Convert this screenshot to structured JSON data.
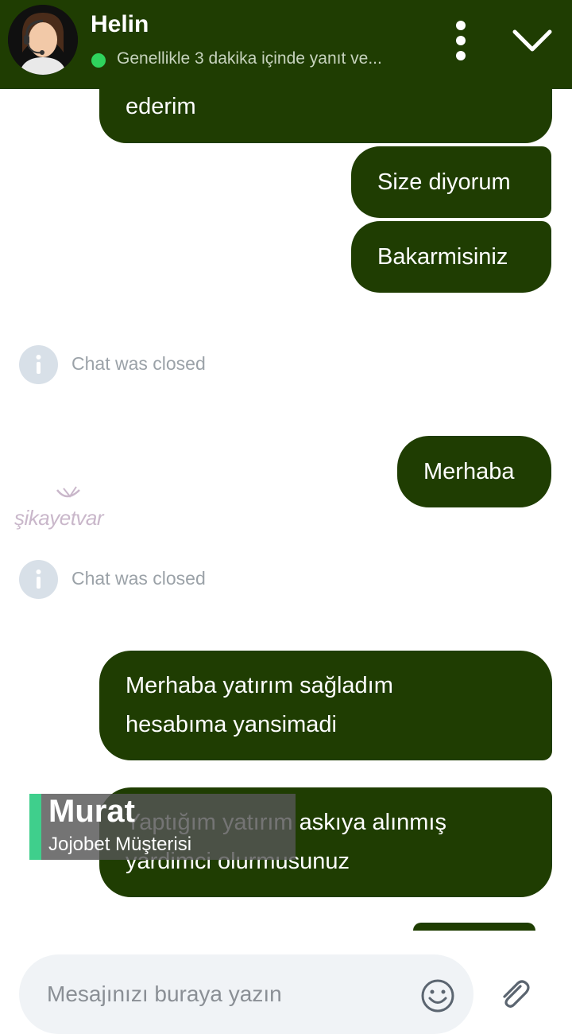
{
  "header": {
    "agent_name": "Helin",
    "status_text": "Genellikle 3 dakika içinde yanıt ve...",
    "status_color": "#2fd45d",
    "menu_icon": "more-vertical-icon",
    "collapse_icon": "chevron-down-icon"
  },
  "messages": [
    {
      "type": "user",
      "text": "ederim"
    },
    {
      "type": "user",
      "text": "Size diyorum"
    },
    {
      "type": "user",
      "text": "Bakarmisiniz"
    },
    {
      "type": "system",
      "text": "Chat was closed"
    },
    {
      "type": "user",
      "text": "Merhaba"
    },
    {
      "type": "system",
      "text": "Chat was closed"
    },
    {
      "type": "user",
      "text_lines": [
        "Merhaba yatırım sağladım",
        "hesabıma yansimadi"
      ]
    },
    {
      "type": "user",
      "text_lines": [
        "Yaptığım yatırım askıya alınmış",
        "yardimci olurmusunuz"
      ]
    }
  ],
  "watermark": {
    "text": "şikayetvar"
  },
  "lower_third": {
    "name": "Murat",
    "subtitle": "Jojobet Müşterisi",
    "accent": "#3fcf8c"
  },
  "composer": {
    "placeholder": "Mesajınızı buraya yazın",
    "emoji_icon": "smiley-icon",
    "attach_icon": "paperclip-icon"
  },
  "colors": {
    "bubble": "#1f3d02",
    "header": "#1f3d02"
  }
}
